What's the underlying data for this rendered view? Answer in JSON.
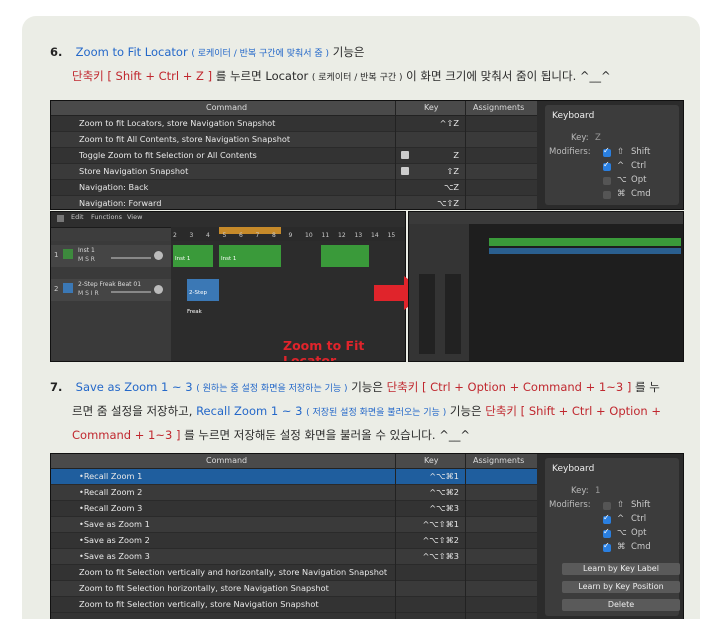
{
  "section6": {
    "num": "6.",
    "title": "Zoom to Fit Locator",
    "title_note": "( 로케이터 / 반복 구간에 맞춰서 줌 )",
    "title_tail": "기능은",
    "shortcut_word": "단축키",
    "shortcut_keys": "[ Shift + Ctrl + Z ]",
    "line2": "를 누르면 Locator",
    "line2_note": "( 로케이터 / 반복 구간 )",
    "line2_tail": "이 화면 크기에 맞춰서 줌이 됩니다. ^__^"
  },
  "table1": {
    "headers": {
      "command": "Command",
      "key": "Key",
      "assignments": "Assignments"
    },
    "rows": [
      {
        "command": "Zoom to fit Locators, store Navigation Snapshot",
        "key": "^⇧Z",
        "icon": false
      },
      {
        "command": "Zoom to fit All Contents, store Navigation Snapshot",
        "key": "",
        "icon": false
      },
      {
        "command": "Toggle Zoom to fit Selection or All Contents",
        "key": "Z",
        "icon": true
      },
      {
        "command": "Store Navigation Snapshot",
        "key": "⇧Z",
        "icon": true
      },
      {
        "command": "Navigation: Back",
        "key": "⌥Z",
        "icon": false
      },
      {
        "command": "Navigation: Forward",
        "key": "⌥⇧Z",
        "icon": false
      }
    ]
  },
  "keyboard1": {
    "title": "Keyboard",
    "key_label": "Key:",
    "key_value": "Z",
    "modifiers_label": "Modifiers:",
    "mods": [
      {
        "sym": "⇧",
        "name": "Shift",
        "checked": true
      },
      {
        "sym": "^",
        "name": "Ctrl",
        "checked": true
      },
      {
        "sym": "⌥",
        "name": "Opt",
        "checked": false
      },
      {
        "sym": "⌘",
        "name": "Cmd",
        "checked": false
      }
    ]
  },
  "daw": {
    "menu": [
      "Edit",
      "Functions",
      "View"
    ],
    "ruler": [
      "2",
      "3",
      "4",
      "5",
      "6",
      "7",
      "8",
      "9",
      "10",
      "11",
      "12",
      "13",
      "14",
      "15"
    ],
    "tracks": [
      {
        "num": "1",
        "name": "Inst 1"
      },
      {
        "num": "2",
        "name": "2-Step Freak Beat 01"
      }
    ],
    "regions": [
      "Inst 1",
      "Inst 1",
      "2-Step Freak"
    ],
    "caption": "Zoom to Fit Locator"
  },
  "section7": {
    "num": "7.",
    "t1": "Save as Zoom 1 ~ 3",
    "t1_note": "( 원하는 줌 설정 화면을 저장하는 기능 )",
    "t1_tail": "기능은",
    "shortcut_word": "단축키",
    "keys1": "[ Ctrl + Option + Command + 1~3 ]",
    "tail1": "를 누",
    "l2a": "르면 줌 설정을 저장하고,",
    "t2": "Recall Zoom 1 ~ 3",
    "t2_note": "( 저장된 설정 화면을 불러오는 기능 )",
    "t2_tail": "기능은",
    "keys2a": "[ Shift + Ctrl + Option +",
    "keys2b": "Command + 1~3 ]",
    "l3": "를 누르면 저장해둔 설정 화면을 불러올 수 있습니다. ^__^"
  },
  "table2": {
    "headers": {
      "command": "Command",
      "key": "Key",
      "assignments": "Assignments"
    },
    "rows": [
      {
        "command": "•Recall Zoom 1",
        "key": "^⌥⌘1",
        "selected": true
      },
      {
        "command": "•Recall Zoom 2",
        "key": "^⌥⌘2",
        "selected": false
      },
      {
        "command": "•Recall Zoom 3",
        "key": "^⌥⌘3",
        "selected": false
      },
      {
        "command": "•Save as Zoom 1",
        "key": "^⌥⇧⌘1",
        "selected": false
      },
      {
        "command": "•Save as Zoom 2",
        "key": "^⌥⇧⌘2",
        "selected": false
      },
      {
        "command": "•Save as Zoom 3",
        "key": "^⌥⇧⌘3",
        "selected": false
      },
      {
        "command": "Zoom to fit Selection vertically and horizontally, store Navigation Snapshot",
        "key": "",
        "selected": false
      },
      {
        "command": "Zoom to fit Selection horizontally, store Navigation Snapshot",
        "key": "",
        "selected": false
      },
      {
        "command": "Zoom to fit Selection vertically, store Navigation Snapshot",
        "key": "",
        "selected": false
      }
    ]
  },
  "keyboard2": {
    "title": "Keyboard",
    "key_label": "Key:",
    "key_value": "1",
    "modifiers_label": "Modifiers:",
    "mods": [
      {
        "sym": "⇧",
        "name": "Shift",
        "checked": false
      },
      {
        "sym": "^",
        "name": "Ctrl",
        "checked": true
      },
      {
        "sym": "⌥",
        "name": "Opt",
        "checked": true
      },
      {
        "sym": "⌘",
        "name": "Cmd",
        "checked": true
      }
    ],
    "buttons": [
      "Learn by Key Label",
      "Learn by Key Position",
      "Delete"
    ]
  }
}
